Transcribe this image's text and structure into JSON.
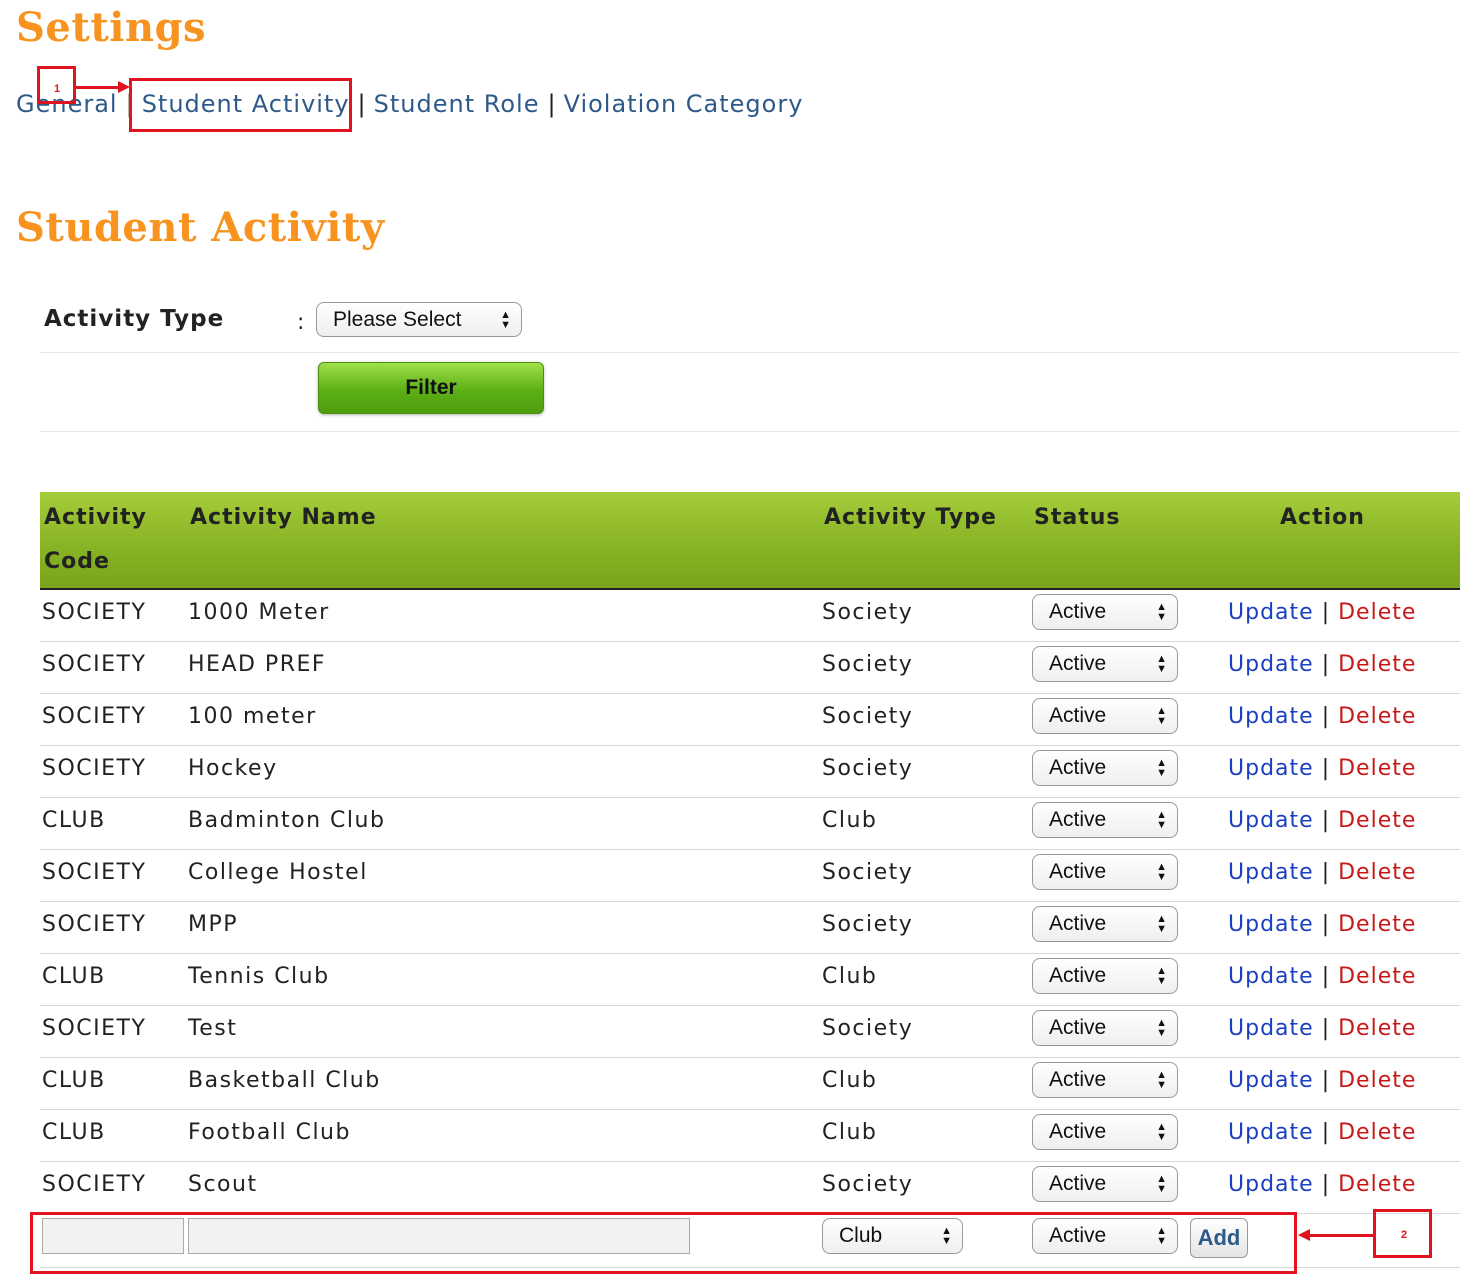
{
  "page": {
    "title": "Settings"
  },
  "nav": {
    "items": [
      {
        "label": "General"
      },
      {
        "label": "Student Activity"
      },
      {
        "label": "Student Role"
      },
      {
        "label": "Violation Category"
      }
    ],
    "separator": "|"
  },
  "section": {
    "title": "Student Activity"
  },
  "filter": {
    "label": "Activity Type",
    "colon": ":",
    "select_value": "Please Select",
    "button_label": "Filter"
  },
  "table": {
    "headers": {
      "code_line1": "Activity",
      "code_line2": "Code",
      "name": "Activity Name",
      "type": "Activity Type",
      "status": "Status",
      "action": "Action"
    },
    "rows": [
      {
        "code": "SOCIETY",
        "name": "1000 Meter",
        "type": "Society",
        "status": "Active"
      },
      {
        "code": "SOCIETY",
        "name": "HEAD PREF",
        "type": "Society",
        "status": "Active"
      },
      {
        "code": "SOCIETY",
        "name": "100 meter",
        "type": "Society",
        "status": "Active"
      },
      {
        "code": "SOCIETY",
        "name": "Hockey",
        "type": "Society",
        "status": "Active"
      },
      {
        "code": "CLUB",
        "name": "Badminton Club",
        "type": "Club",
        "status": "Active"
      },
      {
        "code": "SOCIETY",
        "name": "College Hostel",
        "type": "Society",
        "status": "Active"
      },
      {
        "code": "SOCIETY",
        "name": "MPP",
        "type": "Society",
        "status": "Active"
      },
      {
        "code": "CLUB",
        "name": "Tennis Club",
        "type": "Club",
        "status": "Active"
      },
      {
        "code": "SOCIETY",
        "name": "Test",
        "type": "Society",
        "status": "Active"
      },
      {
        "code": "CLUB",
        "name": "Basketball Club",
        "type": "Club",
        "status": "Active"
      },
      {
        "code": "CLUB",
        "name": "Football Club",
        "type": "Club",
        "status": "Active"
      },
      {
        "code": "SOCIETY",
        "name": "Scout",
        "type": "Society",
        "status": "Active"
      }
    ],
    "update_label": "Update",
    "delete_label": "Delete",
    "action_separator": "|"
  },
  "add_row": {
    "code_value": "",
    "name_value": "",
    "type_select": "Club",
    "status_select": "Active",
    "add_label": "Add"
  },
  "annotations": {
    "marker1": "1",
    "marker2": "2",
    "color": "#e0141e"
  },
  "colors": {
    "title": "#f7931e",
    "link": "#2e5a8a",
    "update": "#1a3fc0",
    "delete": "#c81818",
    "header_green": "#86b224",
    "button_green": "#5cb015"
  }
}
